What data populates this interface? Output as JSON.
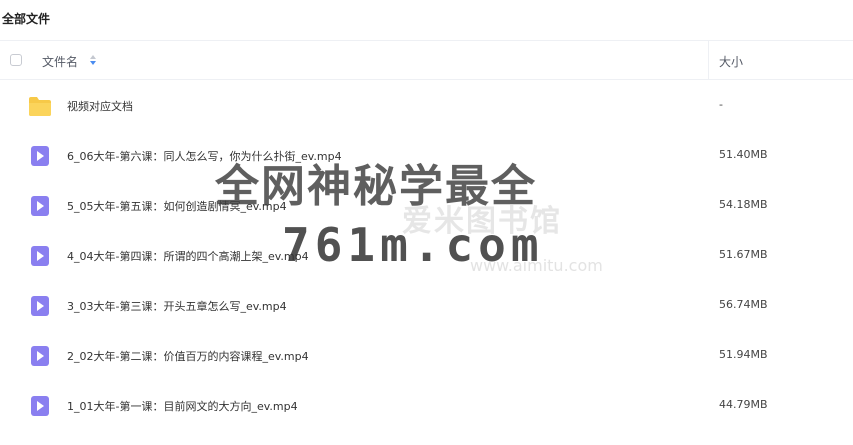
{
  "breadcrumb": "全部文件",
  "header": {
    "name_label": "文件名",
    "size_label": "大小"
  },
  "files": [
    {
      "name": "视频对应文档",
      "size": "-",
      "type": "folder"
    },
    {
      "name": "6_06大年-第六课：同人怎么写，你为什么扑街_ev.mp4",
      "size": "51.40MB",
      "type": "video"
    },
    {
      "name": "5_05大年-第五课：如何创造剧情冥_ev.mp4",
      "size": "54.18MB",
      "type": "video"
    },
    {
      "name": "4_04大年-第四课：所谓的四个高潮上架_ev.mp4",
      "size": "51.67MB",
      "type": "video"
    },
    {
      "name": "3_03大年-第三课：开头五章怎么写_ev.mp4",
      "size": "56.74MB",
      "type": "video"
    },
    {
      "name": "2_02大年-第二课：价值百万的内容课程_ev.mp4",
      "size": "51.94MB",
      "type": "video"
    },
    {
      "name": "1_01大年-第一课：目前网文的大方向_ev.mp4",
      "size": "44.79MB",
      "type": "video"
    }
  ],
  "watermark": {
    "line1": "全网神秘学最全",
    "line2": "761m.com",
    "logo_text": "爱米图书馆",
    "url": "www.aimitu.com"
  },
  "colors": {
    "folder": "#f7c948",
    "video_icon": "#8a7ff0",
    "sort_active": "#4a8cf0"
  }
}
